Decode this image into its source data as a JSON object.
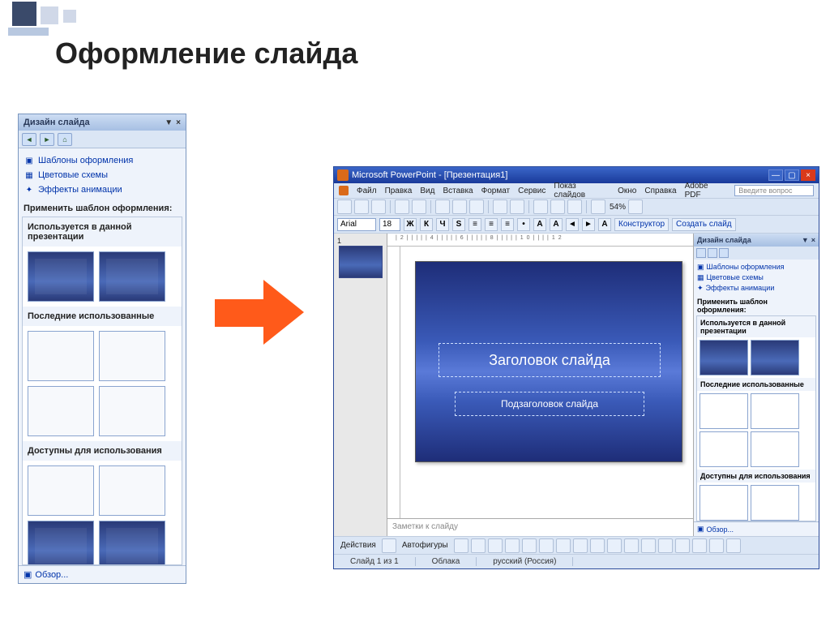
{
  "page": {
    "title": "Оформление слайда"
  },
  "left_panel": {
    "header": "Дизайн слайда",
    "links": [
      {
        "label": "Шаблоны оформления",
        "icon": "templates-icon"
      },
      {
        "label": "Цветовые схемы",
        "icon": "color-schemes-icon"
      },
      {
        "label": "Эффекты анимации",
        "icon": "animation-icon"
      }
    ],
    "apply_label": "Применить шаблон оформления:",
    "groups": [
      {
        "title": "Используется в данной презентации"
      },
      {
        "title": "Последние использованные"
      },
      {
        "title": "Доступны для использования"
      }
    ],
    "footer_label": "Обзор..."
  },
  "pp": {
    "title": "Microsoft PowerPoint - [Презентация1]",
    "menu": [
      "Файл",
      "Правка",
      "Вид",
      "Вставка",
      "Формат",
      "Сервис",
      "Показ слайдов",
      "Окно",
      "Справка",
      "Adobe PDF"
    ],
    "ask_placeholder": "Введите вопрос",
    "zoom": "54%",
    "font_name": "Arial",
    "font_size": "18",
    "fmt_buttons": [
      "Ж",
      "К",
      "Ч",
      "S"
    ],
    "designer_btn": "Конструктор",
    "newslide_btn": "Создать слайд",
    "slide_number": "1",
    "slide": {
      "title_ph": "Заголовок слайда",
      "subtitle_ph": "Подзаголовок слайда"
    },
    "notes_placeholder": "Заметки к слайду",
    "taskpane": {
      "header": "Дизайн слайда",
      "links": [
        "Шаблоны оформления",
        "Цветовые схемы",
        "Эффекты анимации"
      ],
      "apply_label": "Применить шаблон оформления:",
      "groups": [
        "Используется в данной презентации",
        "Последние использованные",
        "Доступны для использования"
      ],
      "footer_label": "Обзор..."
    },
    "draw": {
      "actions": "Действия",
      "autoshapes": "Автофигуры"
    },
    "status": {
      "slide": "Слайд 1 из 1",
      "theme": "Облака",
      "lang": "русский (Россия)"
    }
  }
}
